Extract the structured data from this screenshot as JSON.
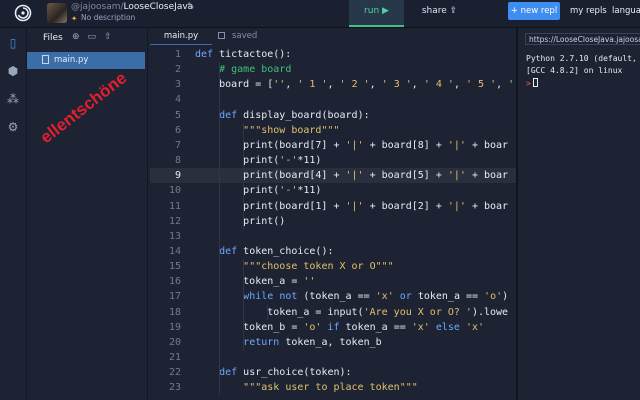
{
  "header": {
    "repl_user": "@jajoosam/",
    "repl_name": "LooseCloseJava",
    "description": "No description",
    "run_label": "run ▶",
    "share_label": "share",
    "new_repl_label": "+ new repl",
    "my_repls_label": "my repls",
    "language_label": "langua"
  },
  "sidebar": {
    "files_label": "Files",
    "file_name": "main.py",
    "watermark": "ellentschöne"
  },
  "editor": {
    "tab_label": "main.py",
    "saved_label": "saved",
    "active_line": 9,
    "lines": [
      {
        "n": "1",
        "t": "def tictactoe():"
      },
      {
        "n": "2",
        "t": "    # game board"
      },
      {
        "n": "3",
        "t": "    board = ['', ' 1 ', ' 2 ', ' 3 ', ' 4 ', ' 5 ', '"
      },
      {
        "n": "4",
        "t": ""
      },
      {
        "n": "5",
        "t": "    def display_board(board):"
      },
      {
        "n": "6",
        "t": "        \"\"\"show board\"\"\""
      },
      {
        "n": "7",
        "t": "        print(board[7] + '|' + board[8] + '|' + boar"
      },
      {
        "n": "8",
        "t": "        print('-'*11)"
      },
      {
        "n": "9",
        "t": "        print(board[4] + '|' + board[5] + '|' + boar"
      },
      {
        "n": "10",
        "t": "        print('-'*11)"
      },
      {
        "n": "11",
        "t": "        print(board[1] + '|' + board[2] + '|' + boar"
      },
      {
        "n": "12",
        "t": "        print()"
      },
      {
        "n": "13",
        "t": ""
      },
      {
        "n": "14",
        "t": "    def token_choice():"
      },
      {
        "n": "15",
        "t": "        \"\"\"choose token X or O\"\"\""
      },
      {
        "n": "16",
        "t": "        token_a = ''"
      },
      {
        "n": "17",
        "t": "        while not (token_a == 'x' or token_a == 'o')"
      },
      {
        "n": "18",
        "t": "            token_a = input('Are you X or O? ').lowe"
      },
      {
        "n": "19",
        "t": "        token_b = 'o' if token_a == 'x' else 'x'"
      },
      {
        "n": "20",
        "t": "        return token_a, token_b"
      },
      {
        "n": "21",
        "t": ""
      },
      {
        "n": "22",
        "t": "    def usr_choice(token):"
      },
      {
        "n": "23",
        "t": "        \"\"\"ask user to place token\"\"\""
      }
    ]
  },
  "console": {
    "url": "https://LooseCloseJava.jajoosam",
    "line1": "Python 2.7.10 (default, J",
    "line2": "[GCC 4.8.2] on linux",
    "prompt": ">"
  },
  "colors": {
    "accent": "#3d8ef0",
    "run_green": "#4fd0a0",
    "keyword": "#6fa8ff",
    "comment": "#3fbf75",
    "string": "#e0c06a"
  }
}
